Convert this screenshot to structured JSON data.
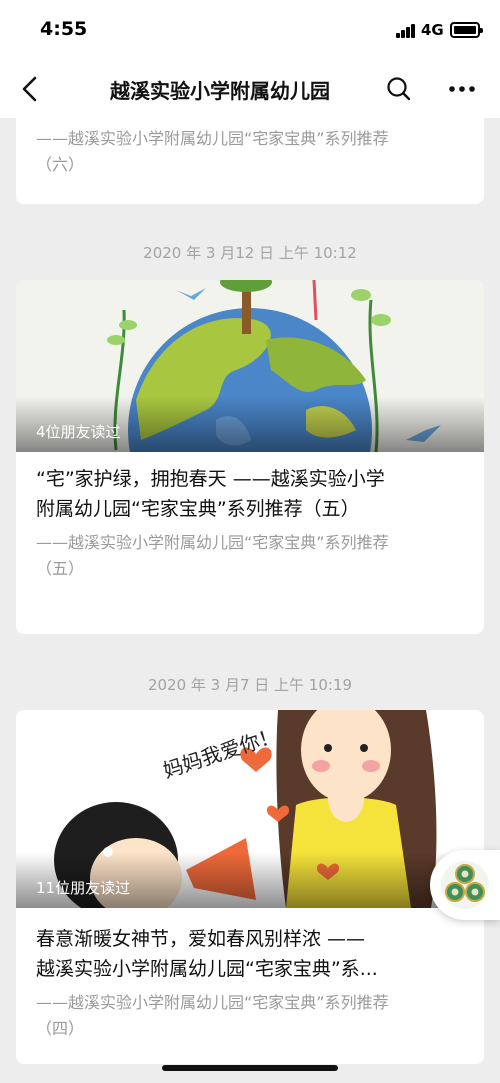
{
  "status_bar": {
    "time": "4:55",
    "network": "4G"
  },
  "nav": {
    "title": "越溪实验小学附属幼儿园"
  },
  "icons": {
    "back": "chevron-left-icon",
    "search": "search-icon",
    "more": "more-icon"
  },
  "articles": [
    {
      "desc_line1": "——越溪实验小学附属幼儿园“宅家宝典”系列推荐",
      "desc_line2": "（六）"
    },
    {
      "date": "2020 年 3 月12 日  上午 10:12",
      "read_count": "4位朋友读过",
      "title_line1": "“宅”家护绿，拥抱春天 ——越溪实验小学",
      "title_line2": "附属幼儿园“宅家宝典”系列推荐（五）",
      "desc_line1": "——越溪实验小学附属幼儿园“宅家宝典”系列推荐",
      "desc_line2": "（五）"
    },
    {
      "date": "2020 年 3 月7 日  上午 10:19",
      "read_count": "11位朋友读过",
      "cover_text": "妈妈我爱你！",
      "title_line1": "春意渐暖女神节，爱如春风别样浓 ——",
      "title_line2": "越溪实验小学附属幼儿园“宅家宝典”系...",
      "desc_line1": "——越溪实验小学附属幼儿园“宅家宝典”系列推荐",
      "desc_line2": "（四）"
    }
  ]
}
